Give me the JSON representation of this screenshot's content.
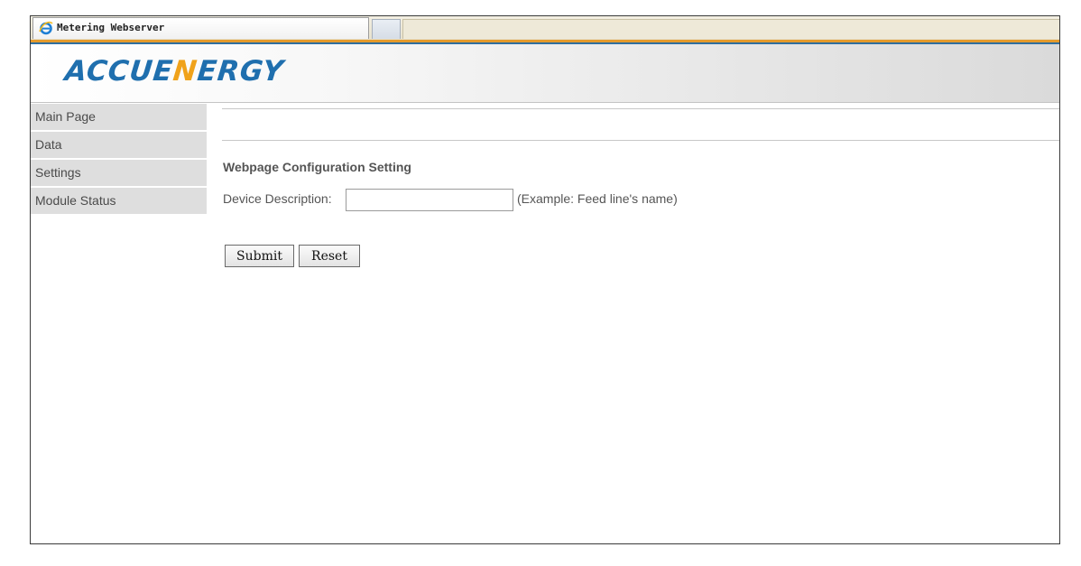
{
  "browser": {
    "tab_title": "Metering Webserver",
    "tab_icon": "ie-icon"
  },
  "header": {
    "logo_part1": "ACCU",
    "logo_part2": "E",
    "logo_part3": "N",
    "logo_part4": "ERGY",
    "brand_color": "#1f6fae",
    "accent_color": "#f0a21a"
  },
  "sidebar": {
    "items": [
      {
        "label": "Main Page"
      },
      {
        "label": "Data"
      },
      {
        "label": "Settings"
      },
      {
        "label": "Module Status"
      }
    ]
  },
  "form": {
    "section_title": "Webpage Configuration Setting",
    "device_label": "Device Description:",
    "device_value": "",
    "device_hint": "(Example: Feed line's name)",
    "submit_label": "Submit",
    "reset_label": "Reset"
  }
}
